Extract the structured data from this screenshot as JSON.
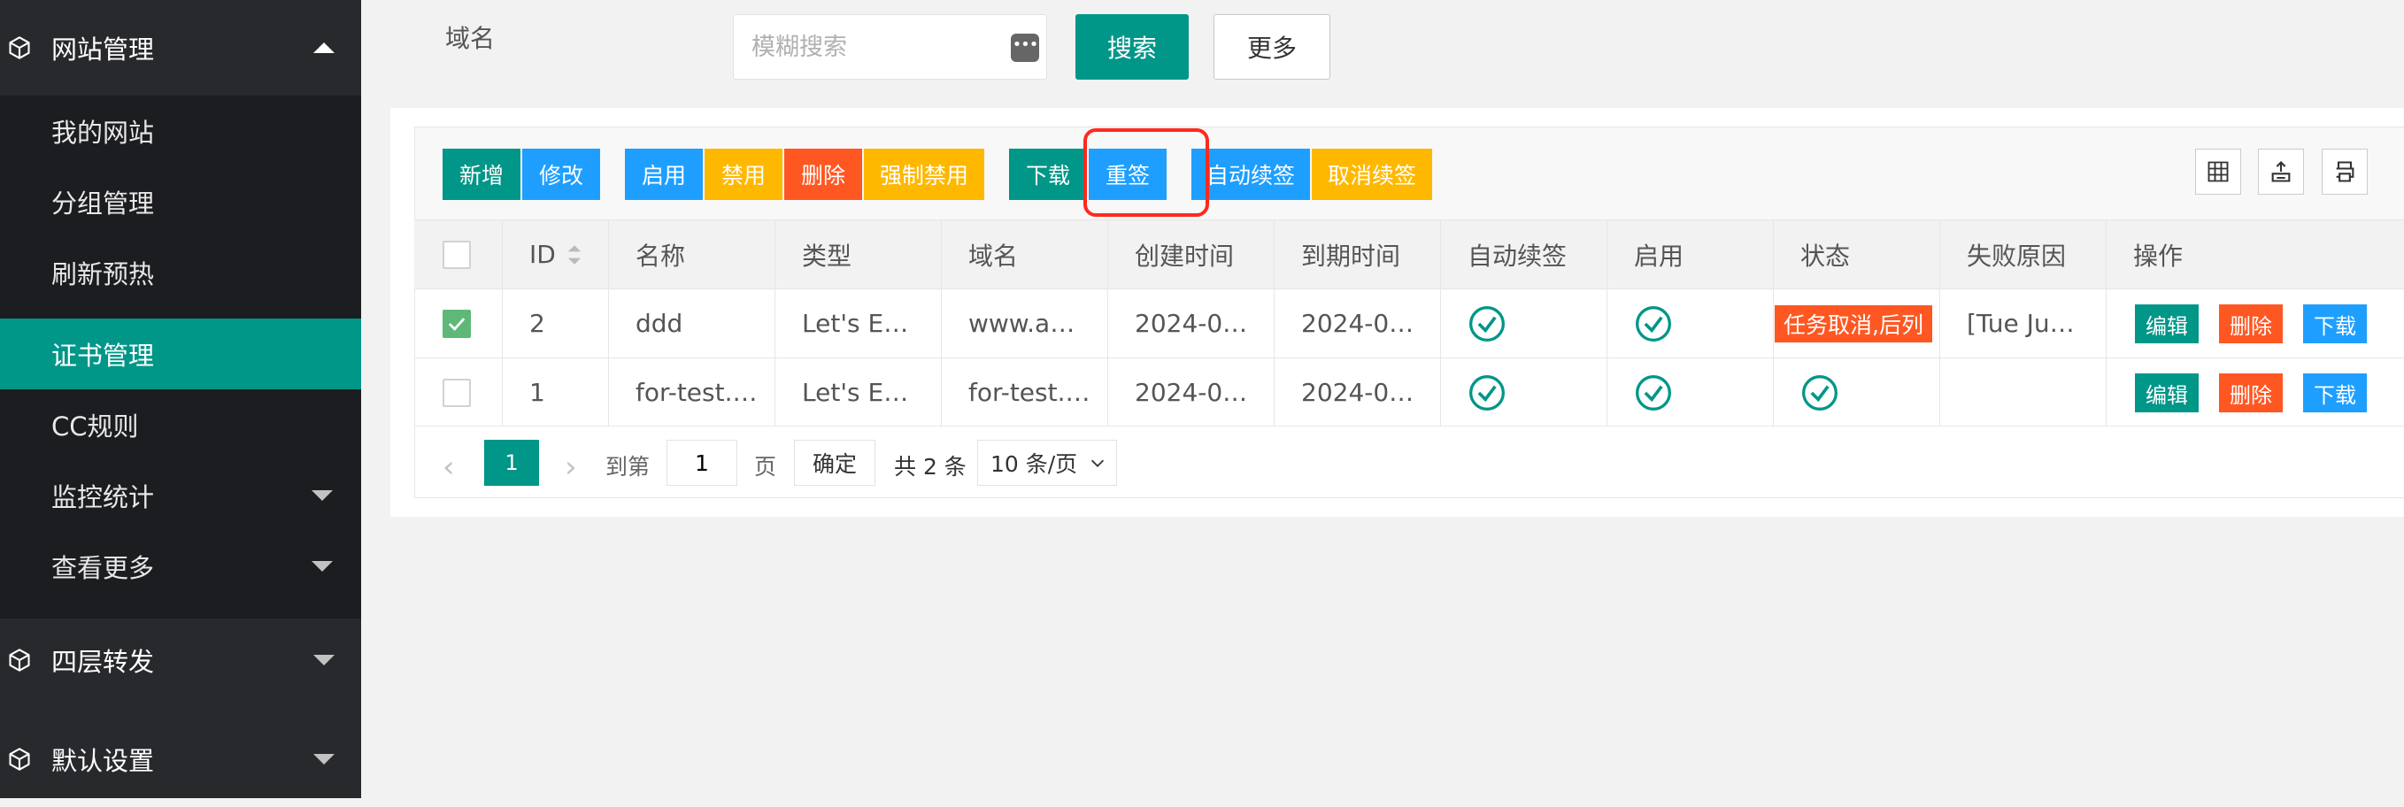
{
  "sidebar": {
    "groups": [
      {
        "label": "网站管理"
      },
      {
        "label": "四层转发"
      },
      {
        "label": "默认设置"
      }
    ],
    "items": [
      {
        "label": "我的网站"
      },
      {
        "label": "分组管理"
      },
      {
        "label": "刷新预热"
      },
      {
        "label": "证书管理"
      },
      {
        "label": "CC规则"
      },
      {
        "label": "监控统计"
      },
      {
        "label": "查看更多"
      }
    ]
  },
  "search": {
    "label": "域名",
    "placeholder": "模糊搜索",
    "dots": "•••",
    "search_label": "搜索",
    "more_label": "更多"
  },
  "toolbar": {
    "add": "新增",
    "edit": "修改",
    "enable": "启用",
    "disable": "禁用",
    "delete": "删除",
    "force_disable": "强制禁用",
    "download": "下载",
    "resign": "重签",
    "auto_renew": "自动续签",
    "cancel_renew": "取消续签"
  },
  "table": {
    "columns": [
      "ID",
      "名称",
      "类型",
      "域名",
      "创建时间",
      "到期时间",
      "自动续签",
      "启用",
      "状态",
      "失败原因",
      "操作"
    ],
    "rows": [
      {
        "checked": true,
        "id": "2",
        "name": "ddd",
        "type": "Let's E…",
        "domain": "www.a…",
        "created": "2024-0…",
        "expires": "2024-0…",
        "status_text": "任务取消,后列",
        "fail_reason": "[Tue Ju…"
      },
      {
        "checked": false,
        "id": "1",
        "name": "for-test.…",
        "type": "Let's E…",
        "domain": "for-test.…",
        "created": "2024-0…",
        "expires": "2024-0…",
        "status_text": "",
        "fail_reason": ""
      }
    ],
    "ops": {
      "edit": "编辑",
      "delete": "删除",
      "download": "下载"
    }
  },
  "pager": {
    "current": "1",
    "goto_label": "到第",
    "goto_value": "1",
    "page_label": "页",
    "ok_label": "确定",
    "total": "共 2 条",
    "page_size": "10 条/页"
  },
  "colors": {
    "primary": "#009688",
    "blue": "#1e9fff",
    "orange": "#ffb800",
    "red": "#ff5722",
    "sidebar": "#28292d",
    "highlight": "#ff2a1f"
  }
}
